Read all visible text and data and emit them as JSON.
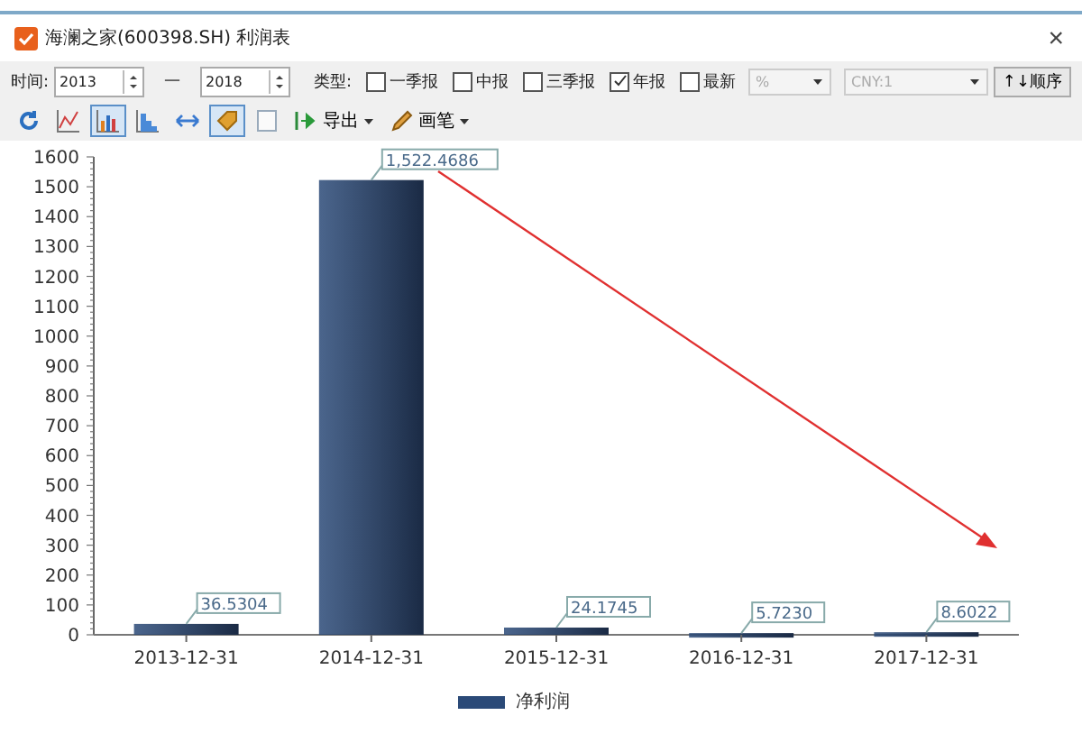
{
  "window": {
    "title": "海澜之家(600398.SH) 利润表",
    "close": "×"
  },
  "filters": {
    "time_label": "时间:",
    "start_year": "2013",
    "separator": "—",
    "end_year": "2018",
    "type_label": "类型:",
    "report_types": [
      {
        "label": "一季报",
        "checked": false
      },
      {
        "label": "中报",
        "checked": false
      },
      {
        "label": "三季报",
        "checked": false
      },
      {
        "label": "年报",
        "checked": true
      },
      {
        "label": "最新",
        "checked": false
      }
    ],
    "unit": "%",
    "currency": "CNY:1",
    "sort_button": "↑↓顺序"
  },
  "toolbar": [
    {
      "kind": "refresh",
      "selected": false
    },
    {
      "kind": "line",
      "selected": false
    },
    {
      "kind": "bar",
      "selected": true
    },
    {
      "kind": "area",
      "selected": false
    },
    {
      "kind": "swap",
      "selected": false
    },
    {
      "kind": "tag",
      "selected": true
    },
    {
      "kind": "blank",
      "selected": false
    },
    {
      "kind": "export",
      "label": "导出",
      "selected": false
    },
    {
      "kind": "pen",
      "label": "画笔",
      "selected": false
    }
  ],
  "chart_data": {
    "type": "bar",
    "categories": [
      "2013-12-31",
      "2014-12-31",
      "2015-12-31",
      "2016-12-31",
      "2017-12-31"
    ],
    "series": [
      {
        "name": "净利润",
        "color": "#2b4a78",
        "values": [
          36.5,
          1522.5,
          24.2,
          5.7,
          8.6
        ]
      }
    ],
    "ylim": [
      0,
      1600
    ],
    "yticks": [
      0,
      100,
      200,
      300,
      400,
      500,
      600,
      700,
      800,
      900,
      1000,
      1100,
      1200,
      1300,
      1400,
      1500,
      1600
    ],
    "value_labels": [
      "36.5304",
      "1,522.4686",
      "24.1745",
      "5.7230",
      "8.6022"
    ]
  }
}
